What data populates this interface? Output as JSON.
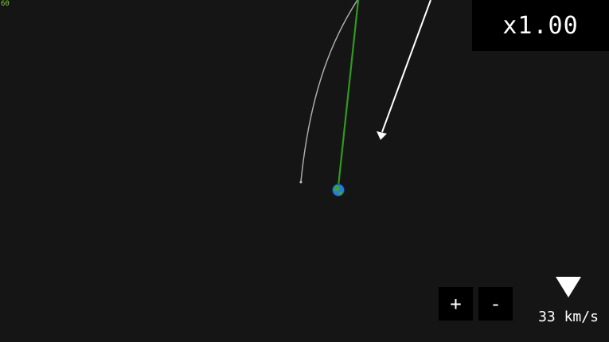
{
  "fps": "60",
  "speed_multiplier": "x1.00",
  "controls": {
    "zoom_in_label": "+",
    "zoom_out_label": "-"
  },
  "velocity": {
    "label": "33 km/s",
    "arrow_icon": "triangle-down-icon"
  },
  "colors": {
    "background": "#151515",
    "fps_text": "#7fd33a",
    "orbit_trail": "#bdbdbd",
    "velocity_line": "#2e9b1c",
    "force_arrow": "#ffffff",
    "panel_bg": "#000000"
  },
  "icons": {
    "planet": "earth-icon",
    "force": "arrow-icon"
  }
}
